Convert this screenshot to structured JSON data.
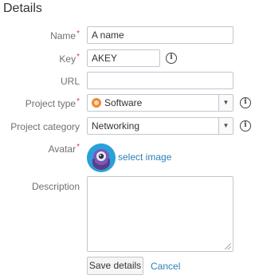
{
  "page": {
    "title": "Details"
  },
  "form": {
    "name": {
      "label": "Name",
      "value": "A name"
    },
    "key": {
      "label": "Key",
      "value": "AKEY"
    },
    "url": {
      "label": "URL",
      "value": ""
    },
    "project_type": {
      "label": "Project type",
      "value": "Software",
      "icon": "software-icon"
    },
    "project_category": {
      "label": "Project category",
      "value": "Networking"
    },
    "avatar": {
      "label": "Avatar",
      "link": "select image"
    },
    "description": {
      "label": "Description",
      "value": ""
    }
  },
  "actions": {
    "save": "Save details",
    "cancel": "Cancel"
  },
  "colors": {
    "required": "#d04437",
    "link": "#2e7fb8",
    "avatar_bg": "#2aa0d8",
    "software_icon": "#f0882e"
  },
  "icons": {
    "info": "info-circle-icon",
    "dropdown": "chevron-down-icon"
  }
}
